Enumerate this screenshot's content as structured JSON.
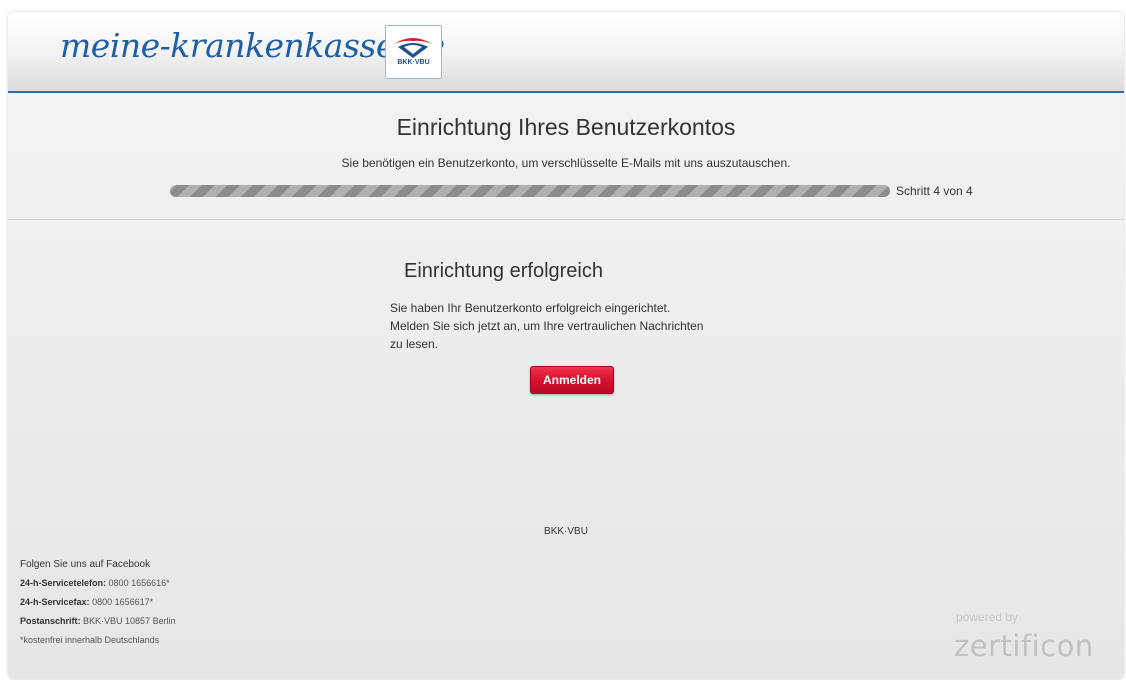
{
  "header": {
    "brand_text": "meine-krankenkasse.de",
    "logo_label": "BKK·VBU"
  },
  "setup": {
    "title": "Einrichtung Ihres Benutzerkontos",
    "subtitle": "Sie benötigen ein Benutzerkonto, um verschlüsselte E-Mails mit uns auszutauschen.",
    "progress": {
      "current_step": 4,
      "total_steps": 4,
      "fraction": 1.0,
      "label": "Schritt 4 von 4"
    }
  },
  "success": {
    "title": "Einrichtung erfolgreich",
    "lines": [
      "Sie haben Ihr Benutzerkonto erfolgreich eingerichtet.",
      "Melden Sie sich jetzt an, um Ihre vertraulichen Nachrichten",
      "zu lesen."
    ],
    "login_button": "Anmelden"
  },
  "footer": {
    "center_text": "BKK·VBU",
    "facebook_link": "Folgen Sie uns auf Facebook",
    "phone_label": "24-h-Servicetelefon:",
    "phone_value": "0800 1656616*",
    "fax_label": "24-h-Servicefax:",
    "fax_value": "0800 1656617*",
    "address_label": "Postanschrift:",
    "address_value": "BKK·VBU 10857 Berlin",
    "note": "*kostenfrei innerhalb Deutschlands",
    "powered_by": "powered by",
    "powered_brand": "zertificon"
  },
  "colors": {
    "brand_blue": "#1f5fa3",
    "button_red": "#d40f2f",
    "header_rule": "#2e6aa8"
  }
}
